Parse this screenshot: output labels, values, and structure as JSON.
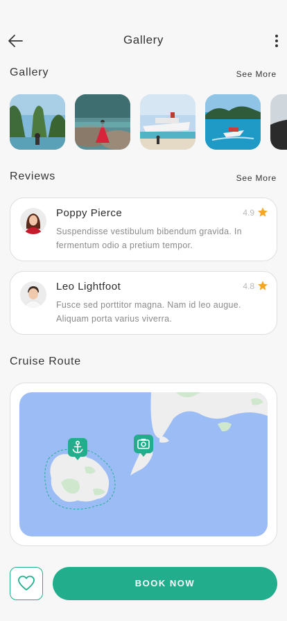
{
  "header": {
    "title": "Gallery",
    "back_icon": "arrow-left-icon",
    "menu_icon": "more-vertical-icon"
  },
  "gallery": {
    "title": "Gallery",
    "see_more": "See More",
    "images": [
      "woman-by-limestone-cliffs",
      "woman-in-red-dress-on-rocks",
      "cruise-ship-at-beach",
      "speedboat-by-island",
      "dark-sand-beach"
    ]
  },
  "reviews": {
    "title": "Reviews",
    "see_more": "See More",
    "items": [
      {
        "name": "Poppy Pierce",
        "rating": "4.9",
        "text": "Suspendisse vestibulum bibendum gravida. In fermentum odio a pretium tempor."
      },
      {
        "name": "Leo Lightfoot",
        "rating": "4.8",
        "text": "Fusce sed porttitor magna. Nam id leo augue. Aliquam porta varius viverra."
      }
    ]
  },
  "route": {
    "title": "Cruise Route",
    "markers": [
      "anchor-icon",
      "camera-icon"
    ]
  },
  "actions": {
    "favorite_icon": "heart-icon",
    "book_label": "BOOK NOW"
  },
  "colors": {
    "accent": "#22ad8c",
    "star": "#f5a623",
    "sea": "#9cbcf5",
    "land": "#eeeeee",
    "vegetation": "#cfe8cd"
  }
}
